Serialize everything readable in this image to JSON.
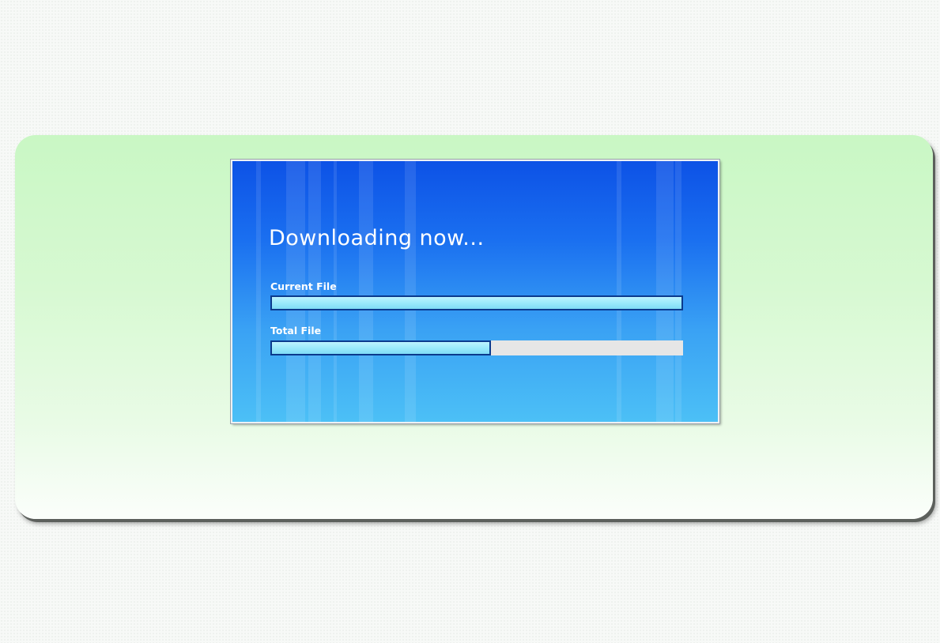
{
  "dialog": {
    "title": "Downloading now...",
    "current_file": {
      "label": "Current File",
      "progress_fraction": 1.0
    },
    "total_file": {
      "label": "Total File",
      "progress_fraction": 0.535
    }
  },
  "colors": {
    "dialog_top": "#0d52e6",
    "dialog_bottom": "#4cc0f6",
    "bar_fill": "#98e8fb",
    "bar_border": "#0b3a8d",
    "bar_track": "#e6e6e6",
    "panel_green": "#c9f7c4"
  }
}
